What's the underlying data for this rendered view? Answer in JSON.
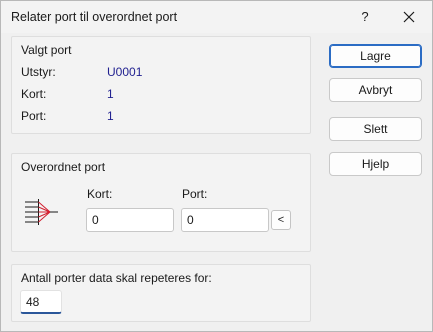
{
  "window": {
    "title": "Relater port til overordnet port",
    "help_label": "?"
  },
  "selected_port": {
    "title": "Valgt port",
    "rows": [
      {
        "label": "Utstyr:",
        "value": "U0001"
      },
      {
        "label": "Kort:",
        "value": "1"
      },
      {
        "label": "Port:",
        "value": "1"
      }
    ]
  },
  "parent_port": {
    "title": "Overordnet port",
    "card_label": "Kort:",
    "card_value": "0",
    "port_label": "Port:",
    "port_value": "0",
    "pick_label": "<"
  },
  "repeat": {
    "title": "Antall porter data skal repeteres for:",
    "value": "48"
  },
  "buttons": {
    "save": "Lagre",
    "cancel": "Avbryt",
    "delete": "Slett",
    "help": "Hjelp"
  },
  "colors": {
    "accent": "#2b579a",
    "value_text": "#1f1f8f",
    "icon_red": "#d21f2f"
  }
}
